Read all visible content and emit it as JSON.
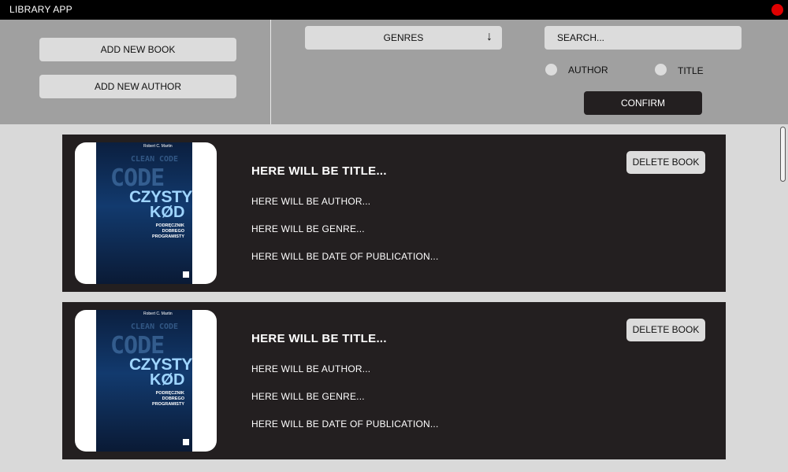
{
  "window": {
    "title": "LIBRARY APP",
    "close_color": "#e00000",
    "close_icon": "red-circle"
  },
  "toolbar": {
    "add_book_label": "ADD NEW BOOK",
    "add_author_label": "ADD NEW AUTHOR",
    "genres": {
      "label": "GENRES",
      "icon": "arrow-down-icon",
      "icon_glyph": "↓"
    },
    "search": {
      "placeholder": "SEARCH...",
      "value": ""
    },
    "radio": {
      "author_label": "AUTHOR",
      "title_label": "TITLE"
    },
    "confirm_label": "CONFIRM"
  },
  "colors": {
    "title_bar": "#000000",
    "toolbar_bg": "#a0a0a0",
    "content_bg": "#d9d9d9",
    "card_bg": "#231f20",
    "button_light": "#dcdcdc",
    "button_dark": "#231f20"
  },
  "books": [
    {
      "title": "HERE WILL BE TITLE...",
      "author": "HERE WILL BE AUTHOR...",
      "genre": "HERE WILL BE GENRE...",
      "date": "HERE WILL BE DATE OF PUBLICATION...",
      "delete_label": "DELETE BOOK",
      "cover": {
        "author": "Robert C. Martin",
        "title_line1": "CZYSTY",
        "title_line2": "KØD",
        "subtitle_line1": "PODRĘCZNIK",
        "subtitle_line2": "DOBREGO PROGRAMISTY",
        "bg_words": [
          "CLEAN",
          "CODE"
        ]
      }
    },
    {
      "title": "HERE WILL BE TITLE...",
      "author": "HERE WILL BE AUTHOR...",
      "genre": "HERE WILL BE GENRE...",
      "date": "HERE WILL BE DATE OF PUBLICATION...",
      "delete_label": "DELETE BOOK",
      "cover": {
        "author": "Robert C. Martin",
        "title_line1": "CZYSTY",
        "title_line2": "KØD",
        "subtitle_line1": "PODRĘCZNIK",
        "subtitle_line2": "DOBREGO PROGRAMISTY",
        "bg_words": [
          "CLEAN",
          "CODE"
        ]
      }
    }
  ]
}
